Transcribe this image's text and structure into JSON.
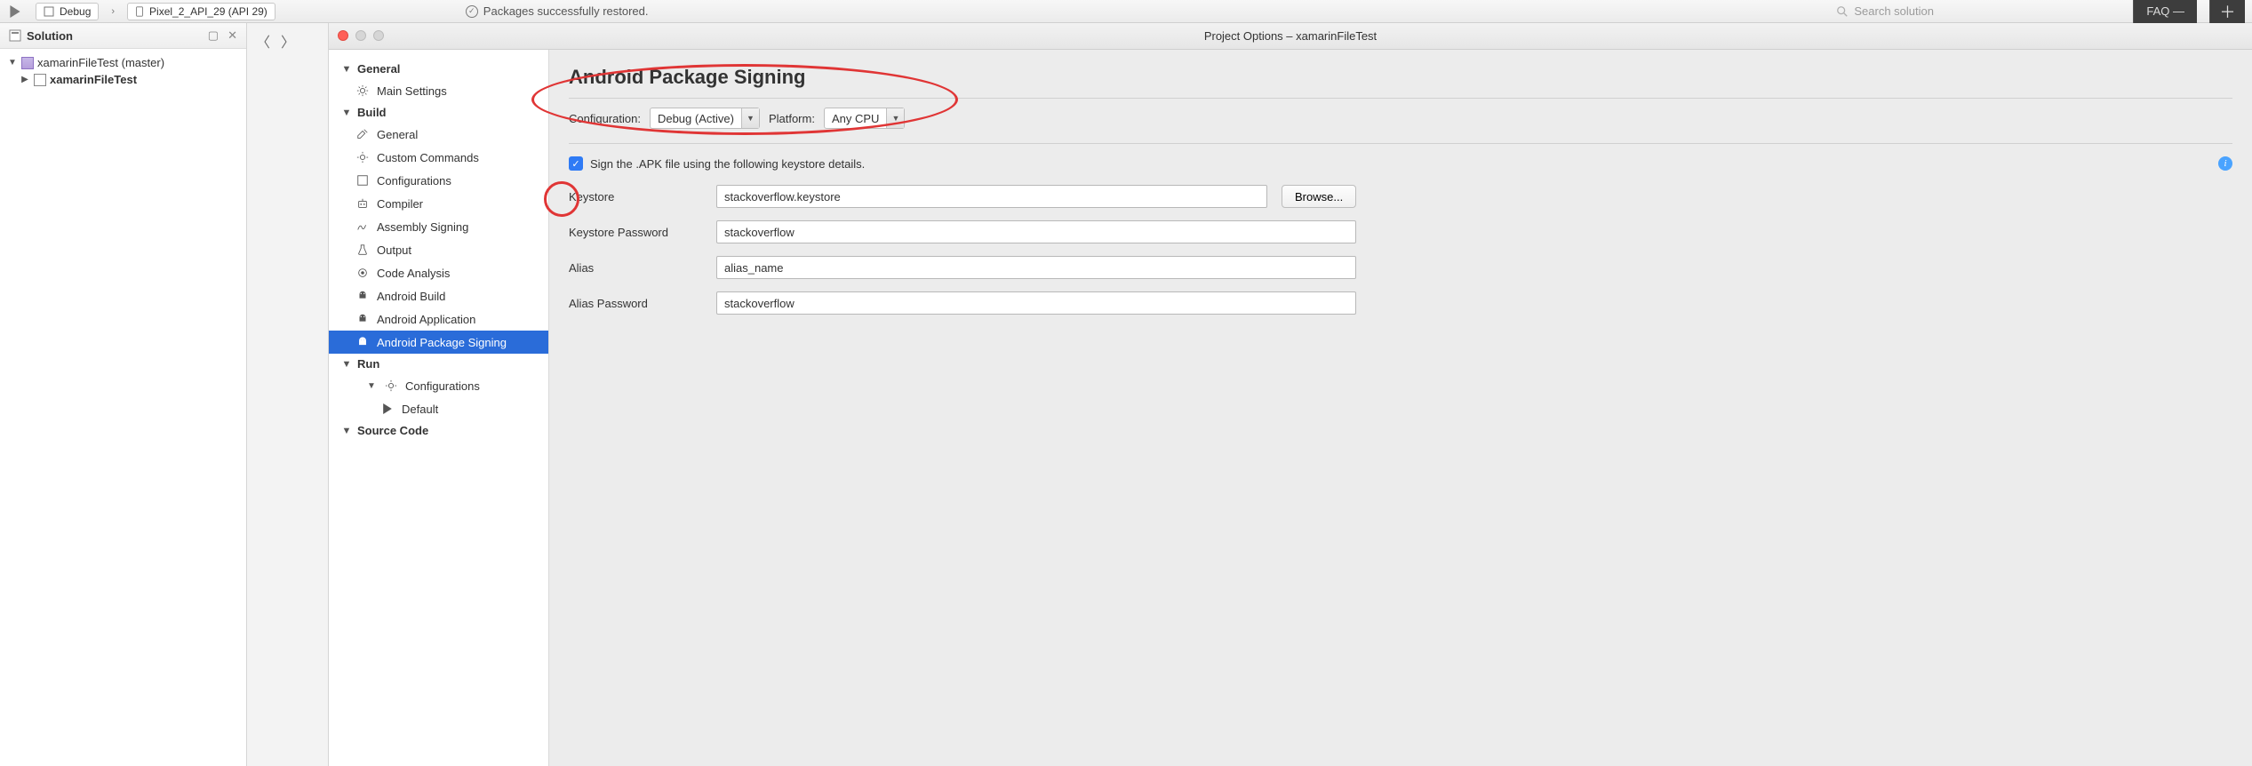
{
  "toolbar": {
    "config_chip": "Debug",
    "device_chip": "Pixel_2_API_29 (API 29)",
    "restore_msg": "Packages successfully restored.",
    "search_placeholder": "Search solution",
    "faq_label": "FAQ —"
  },
  "solution": {
    "title": "Solution",
    "root": "xamarinFileTest (master)",
    "project": "xamarinFileTest"
  },
  "dialog": {
    "title": "Project Options – xamarinFileTest",
    "sections": {
      "general": "General",
      "general_items": {
        "main_settings": "Main Settings"
      },
      "build": "Build",
      "build_items": {
        "general": "General",
        "custom_commands": "Custom Commands",
        "configurations": "Configurations",
        "compiler": "Compiler",
        "assembly_signing": "Assembly Signing",
        "output": "Output",
        "code_analysis": "Code Analysis",
        "android_build": "Android Build",
        "android_application": "Android Application",
        "android_package_signing": "Android Package Signing"
      },
      "run": "Run",
      "run_items": {
        "configurations": "Configurations",
        "default": "Default"
      },
      "source_code": "Source Code"
    },
    "main": {
      "title": "Android Package Signing",
      "configuration_label": "Configuration:",
      "configuration_value": "Debug (Active)",
      "platform_label": "Platform:",
      "platform_value": "Any CPU",
      "sign_label": "Sign the .APK file using the following keystore details.",
      "keystore_label": "Keystore",
      "keystore_value": "stackoverflow.keystore",
      "browse_label": "Browse...",
      "keystore_password_label": "Keystore Password",
      "keystore_password_value": "stackoverflow",
      "alias_label": "Alias",
      "alias_value": "alias_name",
      "alias_password_label": "Alias Password",
      "alias_password_value": "stackoverflow"
    }
  }
}
